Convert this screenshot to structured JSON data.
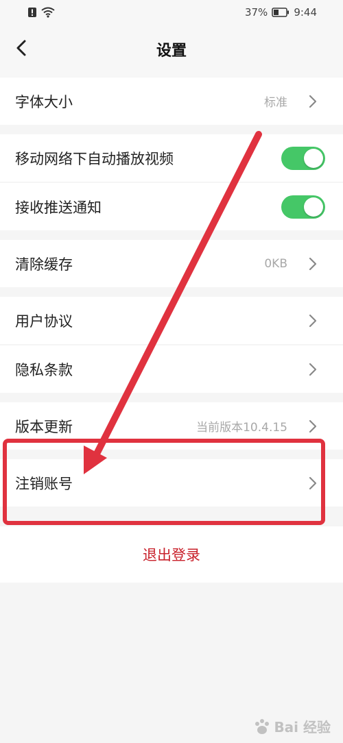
{
  "status_bar": {
    "battery": "37%",
    "time": "9:44"
  },
  "nav": {
    "title": "设置"
  },
  "rows": {
    "font_size": {
      "label": "字体大小",
      "value": "标准"
    },
    "autoplay": {
      "label": "移动网络下自动播放视频",
      "enabled": true
    },
    "push": {
      "label": "接收推送通知",
      "enabled": true
    },
    "cache": {
      "label": "清除缓存",
      "value": "0KB"
    },
    "agreement": {
      "label": "用户协议"
    },
    "privacy": {
      "label": "隐私条款"
    },
    "version": {
      "label": "版本更新",
      "value": "当前版本10.4.15"
    },
    "cancel_account": {
      "label": "注销账号"
    }
  },
  "logout": {
    "label": "退出登录"
  },
  "watermark": {
    "text": "Bai 经验"
  },
  "colors": {
    "toggle_on": "#45c767",
    "logout_text": "#c8202a",
    "annotation": "#e0323f"
  }
}
